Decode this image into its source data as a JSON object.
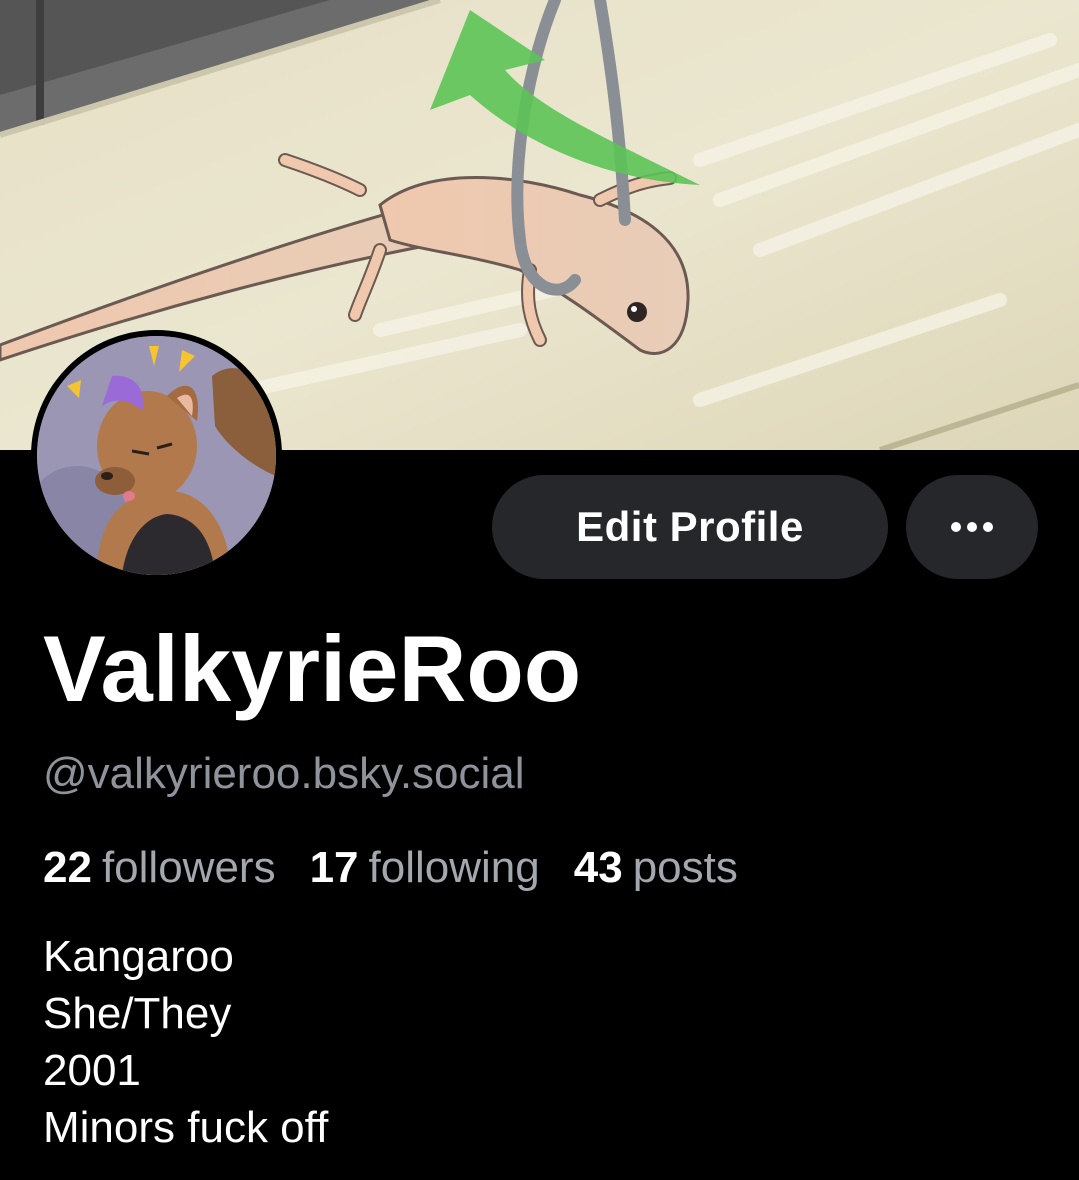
{
  "profile": {
    "display_name": "ValkyrieRoo",
    "handle": "@valkyrieroo.bsky.social"
  },
  "actions": {
    "edit_profile_label": "Edit Profile",
    "more_icon": "ellipsis-icon"
  },
  "stats": {
    "followers_count": "22",
    "followers_label": "followers",
    "following_count": "17",
    "following_label": "following",
    "posts_count": "43",
    "posts_label": "posts"
  },
  "bio": {
    "lines": [
      "Kangaroo",
      "She/They",
      "2001",
      "Minors fuck off"
    ]
  },
  "colors": {
    "background": "#000000",
    "button_bg": "#26272b",
    "handle_text": "#8f949c",
    "stat_label": "#a3a7ae"
  }
}
